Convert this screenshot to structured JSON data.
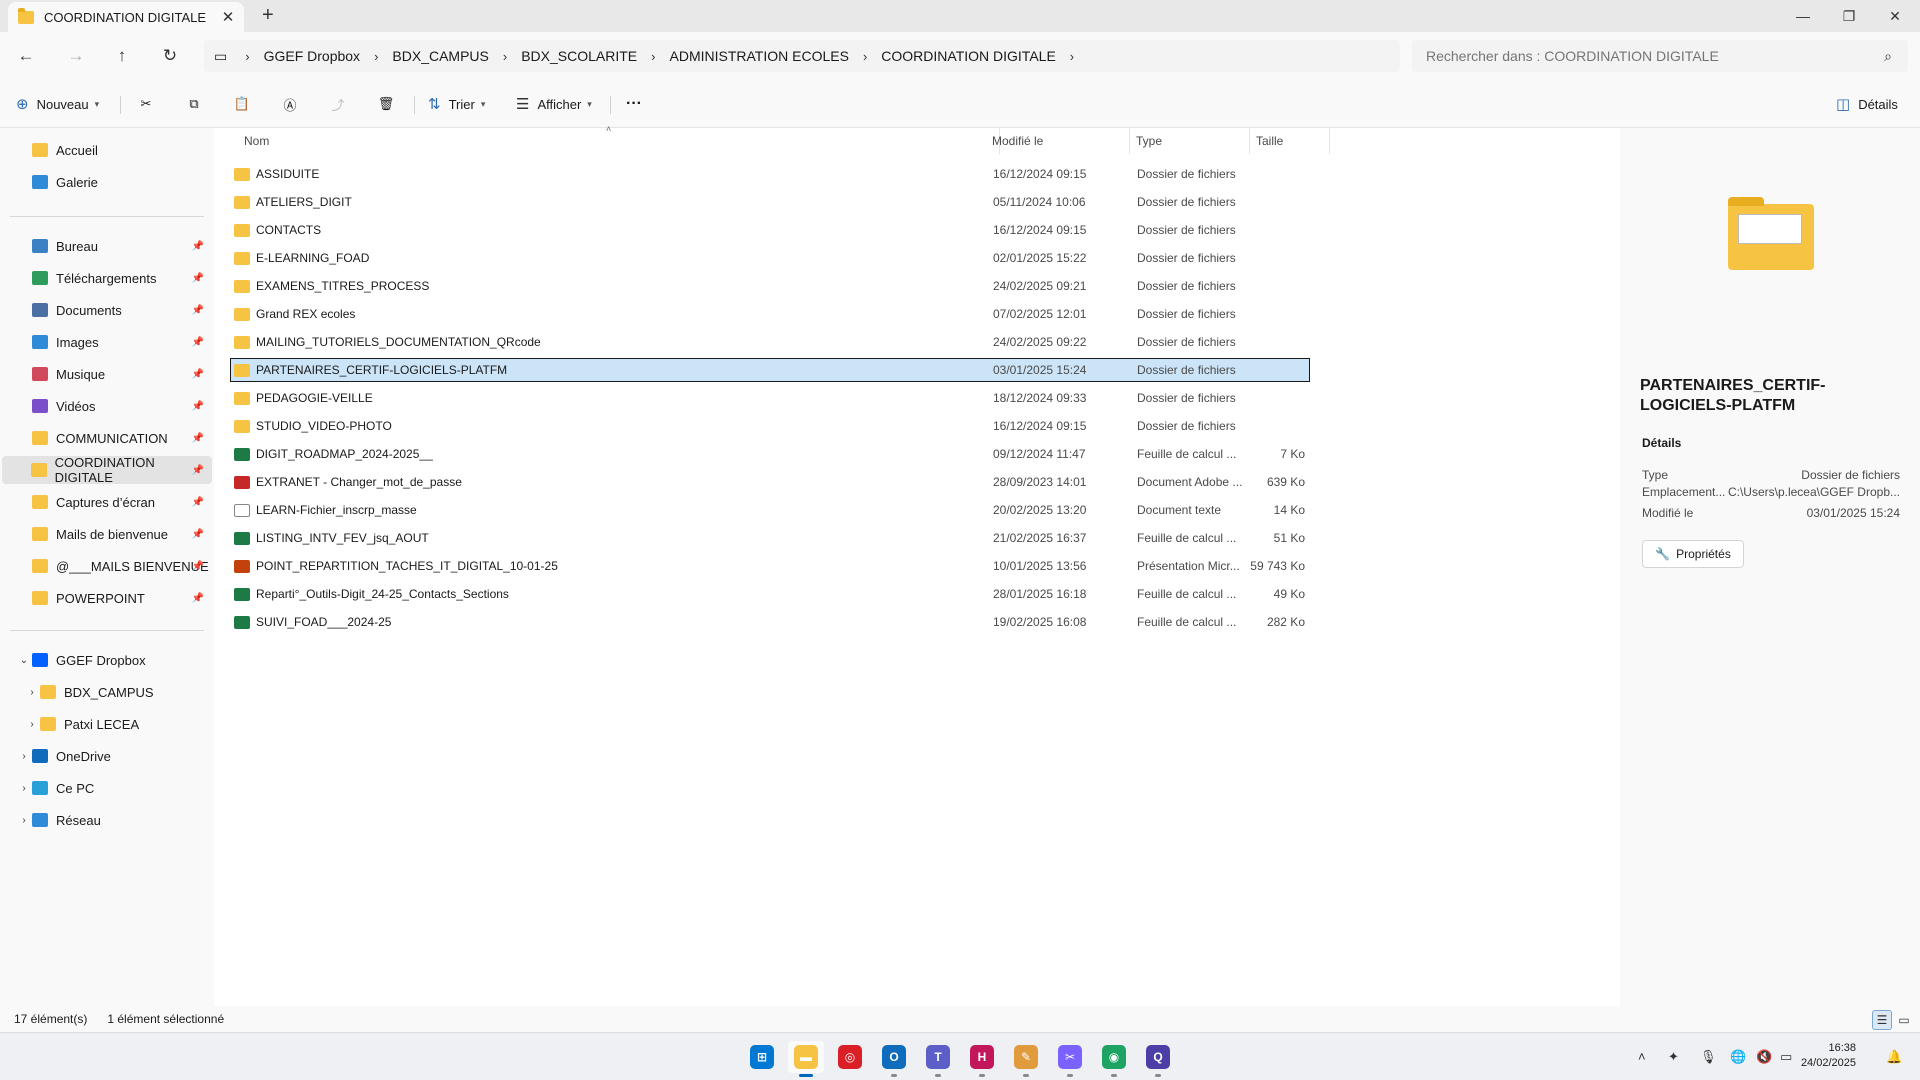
{
  "window": {
    "tab_title": "COORDINATION DIGITALE",
    "new_tab": "+",
    "close_tab": "✕",
    "minimize": "—",
    "restore": "❐",
    "close": "✕"
  },
  "nav_buttons": {
    "back": "←",
    "forward": "→",
    "up": "↑",
    "refresh": "↻"
  },
  "breadcrumb": [
    "GGEF Dropbox",
    "BDX_CAMPUS",
    "BDX_SCOLARITE",
    "ADMINISTRATION ECOLES",
    "COORDINATION DIGITALE"
  ],
  "search": {
    "placeholder": "Rechercher dans : COORDINATION DIGITALE"
  },
  "toolbar": {
    "new_label": "Nouveau",
    "sort_label": "Trier",
    "view_label": "Afficher",
    "more_label": "···",
    "details_label": "Détails"
  },
  "sidebar": {
    "quick": [
      {
        "label": "Accueil",
        "icon": "home-icon"
      },
      {
        "label": "Galerie",
        "icon": "gallery-icon"
      }
    ],
    "pinned": [
      {
        "label": "Bureau",
        "icon": "desktop-icon"
      },
      {
        "label": "Téléchargements",
        "icon": "download-icon"
      },
      {
        "label": "Documents",
        "icon": "documents-icon"
      },
      {
        "label": "Images",
        "icon": "images-icon"
      },
      {
        "label": "Musique",
        "icon": "music-icon"
      },
      {
        "label": "Vidéos",
        "icon": "videos-icon"
      },
      {
        "label": "COMMUNICATION",
        "icon": "folder-icon"
      },
      {
        "label": "COORDINATION DIGITALE",
        "icon": "folder-icon"
      },
      {
        "label": "Captures d’écran",
        "icon": "folder-icon"
      },
      {
        "label": "Mails de bienvenue",
        "icon": "folder-icon"
      },
      {
        "label": "@___MAILS BIENVENUE",
        "icon": "folder-icon"
      },
      {
        "label": "POWERPOINT",
        "icon": "folder-icon"
      }
    ],
    "tree": [
      {
        "label": "GGEF Dropbox",
        "icon": "dropbox-icon"
      },
      {
        "label": "BDX_CAMPUS",
        "icon": "folder-icon"
      },
      {
        "label": "Patxi LECEA",
        "icon": "folder-icon"
      },
      {
        "label": "OneDrive",
        "icon": "onedrive-icon"
      },
      {
        "label": "Ce PC",
        "icon": "pc-icon"
      },
      {
        "label": "Réseau",
        "icon": "network-icon"
      }
    ]
  },
  "columns": {
    "name": "Nom",
    "modified": "Modifié le",
    "type": "Type",
    "size": "Taille"
  },
  "files": [
    {
      "name": "ASSIDUITE",
      "modified": "16/12/2024 09:15",
      "type": "Dossier de fichiers",
      "size": "",
      "kind": "folder"
    },
    {
      "name": "ATELIERS_DIGIT",
      "modified": "05/11/2024 10:06",
      "type": "Dossier de fichiers",
      "size": "",
      "kind": "folder"
    },
    {
      "name": "CONTACTS",
      "modified": "16/12/2024 09:15",
      "type": "Dossier de fichiers",
      "size": "",
      "kind": "folder"
    },
    {
      "name": "E-LEARNING_FOAD",
      "modified": "02/01/2025 15:22",
      "type": "Dossier de fichiers",
      "size": "",
      "kind": "folder"
    },
    {
      "name": "EXAMENS_TITRES_PROCESS",
      "modified": "24/02/2025 09:21",
      "type": "Dossier de fichiers",
      "size": "",
      "kind": "folder"
    },
    {
      "name": "Grand REX ecoles",
      "modified": "07/02/2025 12:01",
      "type": "Dossier de fichiers",
      "size": "",
      "kind": "folder"
    },
    {
      "name": "MAILING_TUTORIELS_DOCUMENTATION_QRcode",
      "modified": "24/02/2025 09:22",
      "type": "Dossier de fichiers",
      "size": "",
      "kind": "folder"
    },
    {
      "name": "PARTENAIRES_CERTIF-LOGICIELS-PLATFM",
      "modified": "03/01/2025 15:24",
      "type": "Dossier de fichiers",
      "size": "",
      "kind": "folder"
    },
    {
      "name": "PEDAGOGIE-VEILLE",
      "modified": "18/12/2024 09:33",
      "type": "Dossier de fichiers",
      "size": "",
      "kind": "folder"
    },
    {
      "name": "STUDIO_VIDEO-PHOTO",
      "modified": "16/12/2024 09:15",
      "type": "Dossier de fichiers",
      "size": "",
      "kind": "folder"
    },
    {
      "name": "DIGIT_ROADMAP_2024-2025__",
      "modified": "09/12/2024 11:47",
      "type": "Feuille de calcul ...",
      "size": "7 Ko",
      "kind": "xls"
    },
    {
      "name": "EXTRANET - Changer_mot_de_passe",
      "modified": "28/09/2023 14:01",
      "type": "Document Adobe ...",
      "size": "639 Ko",
      "kind": "pdf"
    },
    {
      "name": "LEARN-Fichier_inscrp_masse",
      "modified": "20/02/2025 13:20",
      "type": "Document texte",
      "size": "14 Ko",
      "kind": "txt"
    },
    {
      "name": "LISTING_INTV_FEV_jsq_AOUT",
      "modified": "21/02/2025 16:37",
      "type": "Feuille de calcul ...",
      "size": "51 Ko",
      "kind": "xls"
    },
    {
      "name": "POINT_REPARTITION_TACHES_IT_DIGITAL_10-01-25",
      "modified": "10/01/2025 13:56",
      "type": "Présentation Micr...",
      "size": "59 743 Ko",
      "kind": "ppt"
    },
    {
      "name": "Reparti°_Outils-Digit_24-25_Contacts_Sections",
      "modified": "28/01/2025 16:18",
      "type": "Feuille de calcul ...",
      "size": "49 Ko",
      "kind": "xls"
    },
    {
      "name": "SUIVI_FOAD___2024-25",
      "modified": "19/02/2025 16:08",
      "type": "Feuille de calcul ...",
      "size": "282 Ko",
      "kind": "xls"
    }
  ],
  "selected_index": 7,
  "details": {
    "title": "PARTENAIRES_CERTIF-LOGICIELS-PLATFM",
    "section": "Détails",
    "type_label": "Type",
    "type_value": "Dossier de fichiers",
    "location_label": "Emplacement...",
    "location_value": "C:\\Users\\p.lecea\\GGEF Dropb...",
    "modified_label": "Modifié le",
    "modified_value": "03/01/2025 15:24",
    "properties_button": "Propriétés"
  },
  "status": {
    "count": "17 élément(s)",
    "selection": "1 élément sélectionné"
  },
  "taskbar": {
    "apps": [
      {
        "name": "start-icon",
        "color": "#0078d4"
      },
      {
        "name": "file-explorer-icon",
        "color": "#f6c343"
      },
      {
        "name": "creative-cloud-icon",
        "color": "#da1f26"
      },
      {
        "name": "outlook-icon",
        "color": "#0f6cbd"
      },
      {
        "name": "teams-icon",
        "color": "#5b5fc7"
      },
      {
        "name": "h-app-icon",
        "color": "#c2185b"
      },
      {
        "name": "pen-tool-icon",
        "color": "#e09b3d"
      },
      {
        "name": "snipping-tool-icon",
        "color": "#7b61ff"
      },
      {
        "name": "chrome-icon",
        "color": "#1ea362"
      },
      {
        "name": "qt-app-icon",
        "color": "#4b3fa7"
      }
    ],
    "time": "16:38",
    "date": "24/02/2025"
  }
}
